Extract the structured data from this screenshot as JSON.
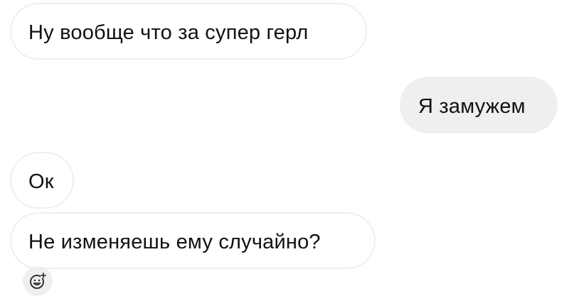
{
  "messages": [
    {
      "direction": "incoming",
      "text": "Ну вообще что за супер герл"
    },
    {
      "direction": "outgoing",
      "text": "Я замужем"
    },
    {
      "direction": "incoming",
      "text": "Ок"
    },
    {
      "direction": "incoming",
      "text": "Не изменяешь ему случайно?"
    }
  ],
  "reaction_button": {
    "icon": "add-reaction-icon"
  },
  "colors": {
    "incoming_bubble": "#ffffff",
    "incoming_border": "#efefef",
    "outgoing_bubble": "#efefef",
    "text": "#111111"
  }
}
